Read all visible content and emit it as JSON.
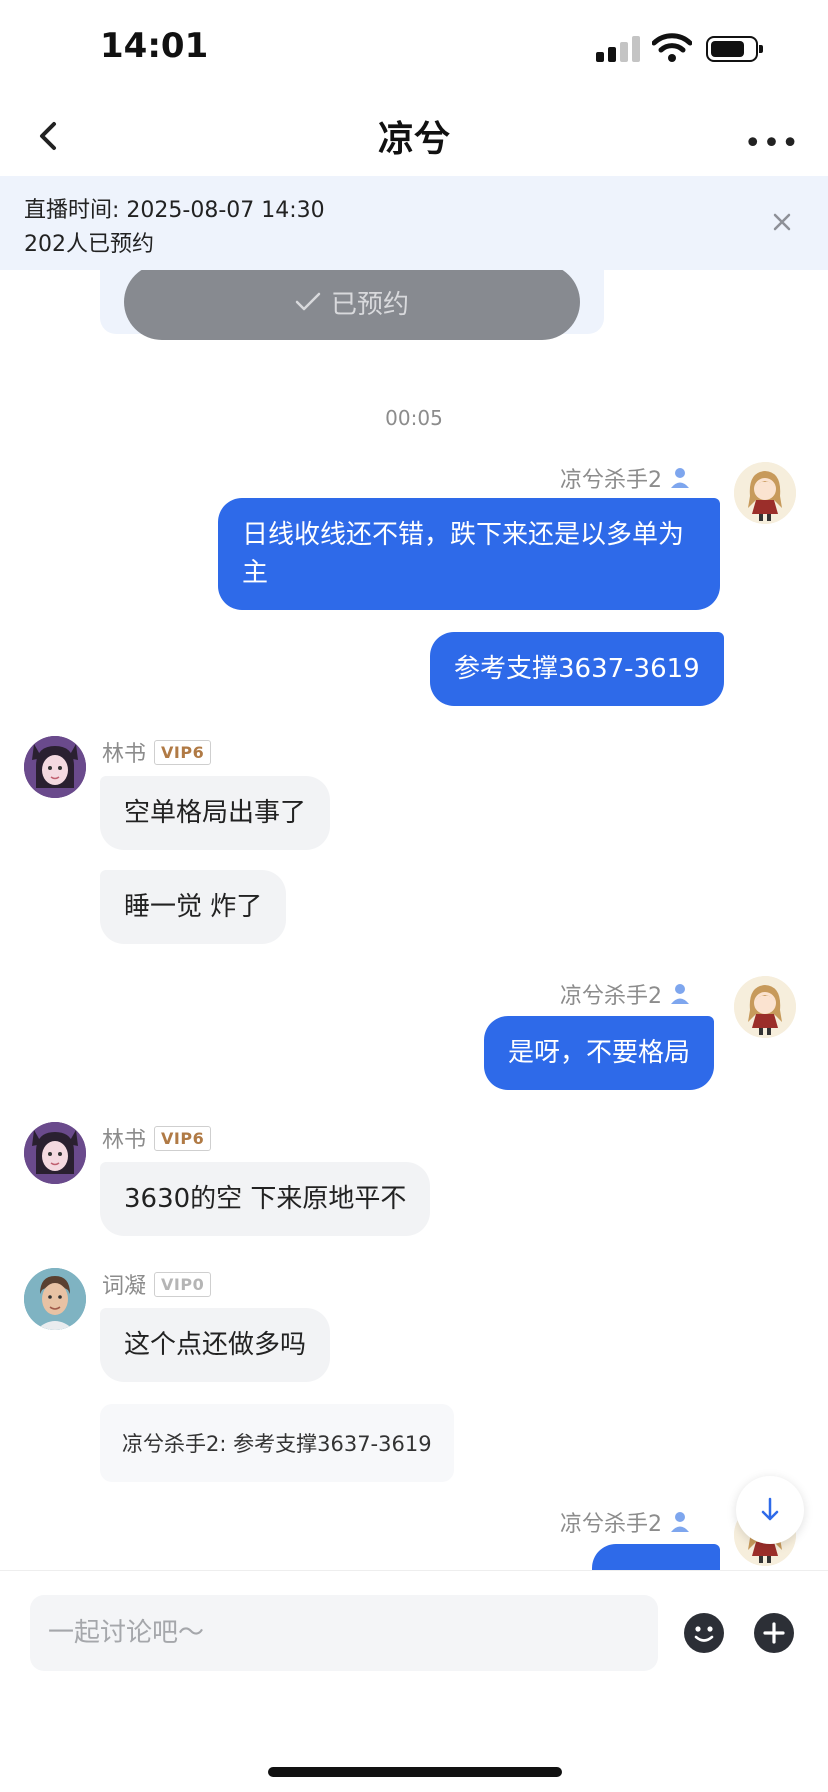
{
  "status_bar": {
    "time": "14:01"
  },
  "nav": {
    "title": "凉兮"
  },
  "banner": {
    "time_text": "直播时间: 2025-08-07 14:30",
    "count_text": "202人已预约"
  },
  "reserve": {
    "label": "已预约"
  },
  "timestamp": "00:05",
  "messages": [
    {
      "sender": "凉兮杀手2",
      "text": "日线收线还不错，跌下来还是以多单为主"
    },
    {
      "sender": "凉兮杀手2",
      "text": "参考支撑3637-3619"
    },
    {
      "sender": "林书",
      "vip": "VIP6",
      "text": "空单格局出事了"
    },
    {
      "sender": "林书",
      "vip": "VIP6",
      "text": "睡一觉 炸了"
    },
    {
      "sender": "凉兮杀手2",
      "text": "是呀，不要格局"
    },
    {
      "sender": "林书",
      "vip": "VIP6",
      "text": "3630的空 下来原地平不"
    },
    {
      "sender": "词凝",
      "vip": "VIP0",
      "text": "这个点还做多吗"
    },
    {
      "quote": "凉兮杀手2: 参考支撑3637-3619"
    },
    {
      "sender": "凉兮杀手2",
      "text": ""
    }
  ],
  "input": {
    "placeholder": "一起讨论吧～"
  },
  "colors": {
    "accent_blue": "#2e6ae9",
    "bubble_gray": "#f2f3f5",
    "banner_bg": "#eef3fc",
    "reserved_button": "#878a90"
  }
}
